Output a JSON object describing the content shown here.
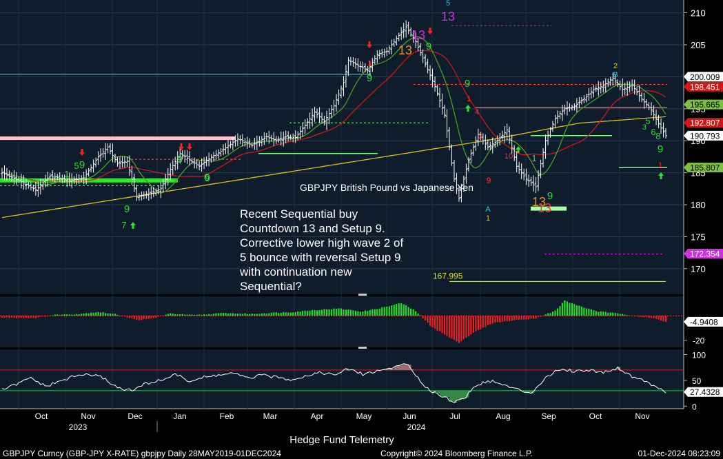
{
  "header": {
    "series_title": "GBPJPY British Pound vs Japanese Yen"
  },
  "annotation": {
    "lines": [
      "Recent Sequential buy",
      "Countdown 13 and Setup 9.",
      "Corrective lower high wave 2 of",
      "5 bounce with reversal Setup 9",
      "with continuation new",
      "Sequential?"
    ]
  },
  "footer": {
    "center_label": "Hedge Fund Telemetry",
    "left_info": "GBPJPY Curncy (GBP-JPY X-RATE) gbpjpy  Daily 28MAY2019-01DEC2024",
    "copyright": "Copyright© 2024 Bloomberg Finance L.P.",
    "timestamp": "01-Dec-2024 08:23:09"
  },
  "colors": {
    "background": "#000000",
    "panel_bg": "#0e1c2c",
    "price_bar": "#ffffff",
    "ma_short": "#d01818",
    "ma_long": "#e0c020",
    "ma_fast": "#4aa020",
    "setup_green": "#33dd33",
    "countdown_red": "#ff3030",
    "pink_level": "#ffc0cb",
    "cyan_level": "#30d0e0",
    "magenta_level": "#d030e0",
    "lime_level": "#c8ff60"
  },
  "chart_data": [
    {
      "type": "line",
      "panel": "price",
      "title": "GBPJPY British Pound vs Japanese Yen",
      "ylim": [
        166,
        212
      ],
      "y_ticks": [
        170,
        175,
        180,
        185,
        190,
        195,
        200,
        205,
        210
      ],
      "x_ticks": [
        "Oct",
        "Nov",
        "Dec",
        "Jan",
        "Feb",
        "Mar",
        "Apr",
        "May",
        "Jun",
        "Jul",
        "Aug",
        "Sep",
        "Oct",
        "Nov"
      ],
      "year_labels": [
        "2023",
        "2024"
      ],
      "x_anchors": [
        [
          0,
          185.0
        ],
        [
          8,
          183.6
        ],
        [
          14,
          182.3
        ],
        [
          20,
          184.5
        ],
        [
          28,
          183.8
        ],
        [
          34,
          184.2
        ],
        [
          40,
          187.5
        ],
        [
          44,
          189.0
        ],
        [
          48,
          186.4
        ],
        [
          52,
          186.8
        ],
        [
          56,
          181.2
        ],
        [
          62,
          181.8
        ],
        [
          66,
          182.5
        ],
        [
          70,
          185.5
        ],
        [
          74,
          188.0
        ],
        [
          78,
          187.0
        ],
        [
          82,
          186.0
        ],
        [
          86,
          187.2
        ],
        [
          92,
          188.6
        ],
        [
          98,
          190.3
        ],
        [
          104,
          189.3
        ],
        [
          110,
          190.6
        ],
        [
          114,
          190.0
        ],
        [
          118,
          190.6
        ],
        [
          122,
          190.5
        ],
        [
          126,
          192.4
        ],
        [
          130,
          194.5
        ],
        [
          134,
          193.0
        ],
        [
          138,
          195.5
        ],
        [
          142,
          199.1
        ],
        [
          144,
          202.6
        ],
        [
          148,
          201.8
        ],
        [
          152,
          201.0
        ],
        [
          156,
          203.5
        ],
        [
          160,
          204.0
        ],
        [
          164,
          206.0
        ],
        [
          168,
          207.8
        ],
        [
          172,
          205.5
        ],
        [
          176,
          202.0
        ],
        [
          180,
          198.5
        ],
        [
          184,
          194.0
        ],
        [
          188,
          184.0
        ],
        [
          190,
          181.0
        ],
        [
          194,
          187.0
        ],
        [
          198,
          191.0
        ],
        [
          202,
          189.0
        ],
        [
          206,
          190.0
        ],
        [
          210,
          191.7
        ],
        [
          214,
          186.0
        ],
        [
          218,
          184.0
        ],
        [
          222,
          182.8
        ],
        [
          226,
          190.0
        ],
        [
          230,
          193.5
        ],
        [
          234,
          195.0
        ],
        [
          238,
          195.4
        ],
        [
          242,
          196.6
        ],
        [
          246,
          198.0
        ],
        [
          250,
          198.6
        ],
        [
          254,
          199.8
        ],
        [
          258,
          198.0
        ],
        [
          262,
          198.7
        ],
        [
          266,
          196.5
        ],
        [
          270,
          194.8
        ],
        [
          274,
          192.0
        ],
        [
          276,
          190.79
        ]
      ],
      "series": [
        {
          "name": "Price",
          "color": "#ffffff"
        },
        {
          "name": "Moving average (red)",
          "color": "#d01818"
        },
        {
          "name": "Moving average (yellow)",
          "color": "#e0c020"
        },
        {
          "name": "Moving average (green)",
          "color": "#4aa020"
        }
      ],
      "price_labels": [
        {
          "value": 200.009,
          "text": "200.009",
          "bg": "#ffffff",
          "fg": "#000000"
        },
        {
          "value": 198.451,
          "text": "198.451",
          "bg": "#d01818",
          "fg": "#ffffff"
        },
        {
          "value": 195.665,
          "text": "195.665",
          "bg": "#7fbf3f",
          "fg": "#000000"
        },
        {
          "value": 192.807,
          "text": "192.807",
          "bg": "#d01818",
          "fg": "#ffffff"
        },
        {
          "value": 190.793,
          "text": "190.793",
          "bg": "#ffffff",
          "fg": "#000000"
        },
        {
          "value": 185.807,
          "text": "185.807",
          "bg": "#7fbf3f",
          "fg": "#000000"
        },
        {
          "value": 172.354,
          "text": "172.354",
          "bg": "#d030e0",
          "fg": "#ffffff"
        }
      ],
      "level_label": {
        "value": 167.995,
        "text": "167.995",
        "color": "#e0e020"
      },
      "sequential_labels": [
        {
          "text": "5",
          "x": 650,
          "y": 8,
          "color": "#30c0e0",
          "size": 11
        },
        {
          "text": "13",
          "x": 650,
          "y": 30,
          "color": "#d030e0",
          "size": 18
        },
        {
          "text": "13",
          "x": 607,
          "y": 57,
          "color": "#d030e0",
          "size": 18
        },
        {
          "text": "13",
          "x": 588,
          "y": 79,
          "color": "#f09020",
          "size": 18
        },
        {
          "text": "1",
          "x": 536,
          "y": 95,
          "color": "#ff3030",
          "size": 11
        },
        {
          "text": "9",
          "x": 622,
          "y": 72,
          "color": "#33dd33",
          "size": 15
        },
        {
          "text": "9",
          "x": 536,
          "y": 118,
          "color": "#33dd33",
          "size": 15
        },
        {
          "text": "9",
          "x": 678,
          "y": 126,
          "color": "#33dd33",
          "size": 15
        },
        {
          "text": "9",
          "x": 119,
          "y": 244,
          "color": "#33dd33",
          "size": 15
        },
        {
          "text": "9",
          "x": 261,
          "y": 236,
          "color": "#33dd33",
          "size": 15
        },
        {
          "text": "9",
          "x": 301,
          "y": 263,
          "color": "#33dd33",
          "size": 15
        },
        {
          "text": "9",
          "x": 184,
          "y": 308,
          "color": "#33dd33",
          "size": 15
        },
        {
          "text": "9",
          "x": 798,
          "y": 289,
          "color": "#33dd33",
          "size": 15
        },
        {
          "text": "9",
          "x": 958,
          "y": 221,
          "color": "#33dd33",
          "size": 15
        },
        {
          "text": "9",
          "x": 709,
          "y": 266,
          "color": "#ff3030",
          "size": 12
        },
        {
          "text": "13",
          "x": 782,
          "y": 299,
          "color": "#f09020",
          "size": 18
        },
        {
          "text": "13",
          "x": 790,
          "y": 308,
          "color": "#ff3030",
          "size": 18
        },
        {
          "text": "2",
          "x": 893,
          "y": 99,
          "color": "#e0d040",
          "size": 11
        },
        {
          "text": "B",
          "x": 893,
          "y": 112,
          "color": "#30d0e0",
          "size": 11
        },
        {
          "text": "A",
          "x": 708,
          "y": 307,
          "color": "#30d0e0",
          "size": 11
        },
        {
          "text": "1",
          "x": 708,
          "y": 320,
          "color": "#e0d040",
          "size": 11
        },
        {
          "text": "1",
          "x": 958,
          "y": 243,
          "color": "#ff3030",
          "size": 11
        },
        {
          "text": "1",
          "x": 680,
          "y": 147,
          "color": "#ff3030",
          "size": 11
        },
        {
          "text": "3",
          "x": 697,
          "y": 201,
          "color": "#ff3030",
          "size": 11
        },
        {
          "text": "4",
          "x": 692,
          "y": 166,
          "color": "#ff3030",
          "size": 11
        },
        {
          "text": "10",
          "x": 738,
          "y": 230,
          "color": "#ff3030",
          "size": 11
        },
        {
          "text": "7",
          "x": 180,
          "y": 331,
          "color": "#33dd33",
          "size": 13
        },
        {
          "text": "6",
          "x": 300,
          "y": 262,
          "color": "#33dd33",
          "size": 15
        },
        {
          "text": "5",
          "x": 111,
          "y": 245,
          "color": "#33dd33",
          "size": 13
        },
        {
          "text": "1",
          "x": 97,
          "y": 257,
          "color": "#33dd33",
          "size": 13
        },
        {
          "text": "1",
          "x": 775,
          "y": 234,
          "color": "#33dd33",
          "size": 13
        },
        {
          "text": "8",
          "x": 955,
          "y": 202,
          "color": "#33dd33",
          "size": 13
        },
        {
          "text": "6",
          "x": 948,
          "y": 196,
          "color": "#33dd33",
          "size": 13
        },
        {
          "text": "5",
          "x": 940,
          "y": 180,
          "color": "#33dd33",
          "size": 13
        },
        {
          "text": "3",
          "x": 935,
          "y": 188,
          "color": "#33dd33",
          "size": 11
        }
      ]
    },
    {
      "type": "bar",
      "panel": "momentum",
      "ylim": [
        -26,
        16
      ],
      "y_ticks": [
        -20
      ],
      "label": {
        "value": -4.9408,
        "text": "-4.9408"
      },
      "x_anchors": [
        [
          0,
          -1.5
        ],
        [
          14,
          -1.8
        ],
        [
          22,
          0.8
        ],
        [
          32,
          1.5
        ],
        [
          40,
          3.2
        ],
        [
          48,
          1.0
        ],
        [
          56,
          -3.5
        ],
        [
          62,
          -2.5
        ],
        [
          70,
          1.8
        ],
        [
          80,
          0.5
        ],
        [
          92,
          2.2
        ],
        [
          104,
          1.5
        ],
        [
          112,
          2.5
        ],
        [
          120,
          3.0
        ],
        [
          128,
          4.5
        ],
        [
          140,
          6.0
        ],
        [
          150,
          3.5
        ],
        [
          160,
          7.5
        ],
        [
          166,
          10.5
        ],
        [
          172,
          4.0
        ],
        [
          178,
          -8.0
        ],
        [
          186,
          -18.0
        ],
        [
          190,
          -22.0
        ],
        [
          196,
          -14.0
        ],
        [
          204,
          -6.0
        ],
        [
          214,
          -3.5
        ],
        [
          222,
          -2.0
        ],
        [
          230,
          4.0
        ],
        [
          234,
          12.5
        ],
        [
          240,
          8.0
        ],
        [
          248,
          3.5
        ],
        [
          258,
          1.5
        ],
        [
          266,
          -1.0
        ],
        [
          272,
          -2.5
        ],
        [
          276,
          -4.9
        ]
      ]
    },
    {
      "type": "line",
      "panel": "rsi",
      "ylim": [
        -5,
        110
      ],
      "y_ticks": [
        0,
        50,
        100
      ],
      "bands": [
        70,
        30
      ],
      "label": {
        "value": 27.4328,
        "text": "27.4328"
      },
      "x_anchors": [
        [
          0,
          32
        ],
        [
          6,
          42
        ],
        [
          12,
          55
        ],
        [
          18,
          38
        ],
        [
          24,
          48
        ],
        [
          30,
          58
        ],
        [
          36,
          62
        ],
        [
          42,
          55
        ],
        [
          48,
          36
        ],
        [
          54,
          30
        ],
        [
          60,
          44
        ],
        [
          66,
          50
        ],
        [
          72,
          62
        ],
        [
          78,
          48
        ],
        [
          84,
          56
        ],
        [
          90,
          60
        ],
        [
          96,
          64
        ],
        [
          102,
          54
        ],
        [
          108,
          60
        ],
        [
          114,
          56
        ],
        [
          120,
          52
        ],
        [
          126,
          58
        ],
        [
          132,
          66
        ],
        [
          138,
          60
        ],
        [
          144,
          72
        ],
        [
          150,
          62
        ],
        [
          156,
          68
        ],
        [
          162,
          74
        ],
        [
          168,
          84
        ],
        [
          172,
          58
        ],
        [
          178,
          30
        ],
        [
          184,
          18
        ],
        [
          188,
          8
        ],
        [
          192,
          14
        ],
        [
          196,
          36
        ],
        [
          202,
          50
        ],
        [
          208,
          42
        ],
        [
          214,
          32
        ],
        [
          220,
          26
        ],
        [
          226,
          55
        ],
        [
          232,
          72
        ],
        [
          238,
          68
        ],
        [
          244,
          70
        ],
        [
          250,
          66
        ],
        [
          256,
          74
        ],
        [
          262,
          58
        ],
        [
          268,
          48
        ],
        [
          272,
          36
        ],
        [
          276,
          27
        ]
      ]
    }
  ]
}
